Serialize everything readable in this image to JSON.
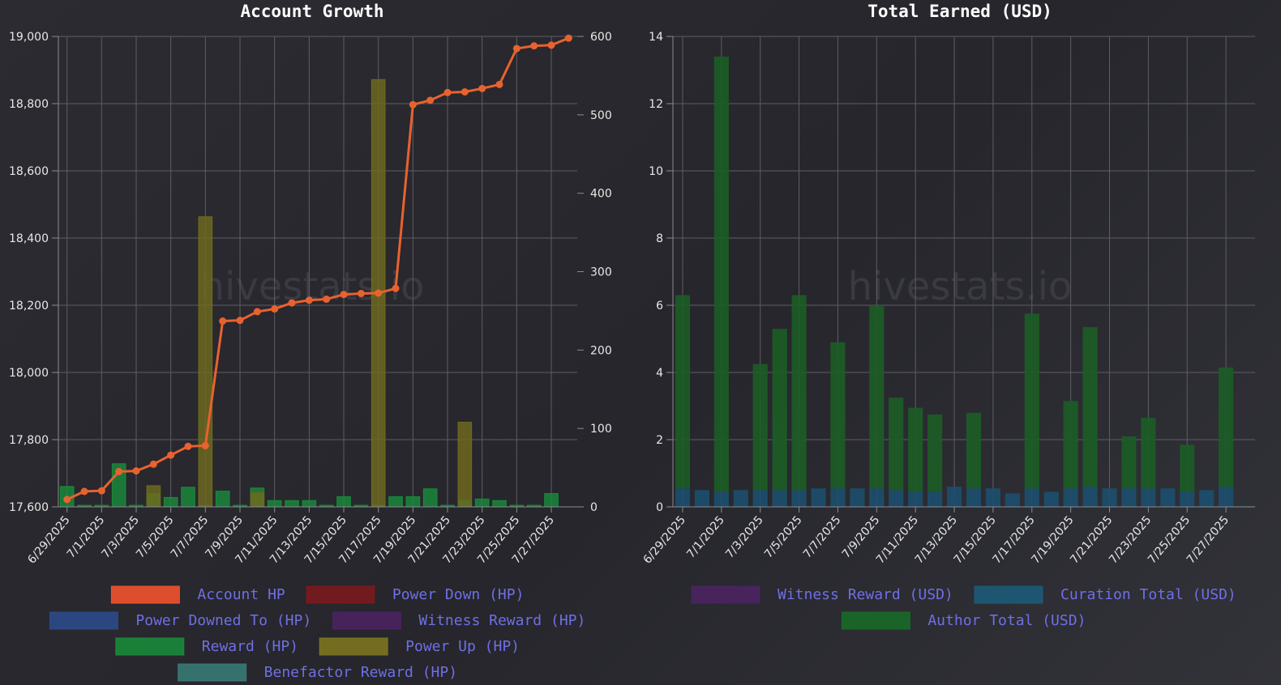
{
  "watermark": "hivestats.io",
  "chart_data": [
    {
      "type": "bar",
      "title": "Account Growth",
      "x_labels": [
        "6/29/2025",
        "7/1/2025",
        "7/3/2025",
        "7/5/2025",
        "7/7/2025",
        "7/9/2025",
        "7/11/2025",
        "7/13/2025",
        "7/15/2025",
        "7/17/2025",
        "7/19/2025",
        "7/21/2025",
        "7/23/2025",
        "7/25/2025",
        "7/27/2025"
      ],
      "dates": [
        "6/29/2025",
        "6/30/2025",
        "7/1/2025",
        "7/2/2025",
        "7/3/2025",
        "7/4/2025",
        "7/5/2025",
        "7/6/2025",
        "7/7/2025",
        "7/8/2025",
        "7/9/2025",
        "7/10/2025",
        "7/11/2025",
        "7/12/2025",
        "7/13/2025",
        "7/14/2025",
        "7/15/2025",
        "7/16/2025",
        "7/17/2025",
        "7/18/2025",
        "7/19/2025",
        "7/20/2025",
        "7/21/2025",
        "7/22/2025",
        "7/23/2025",
        "7/24/2025",
        "7/25/2025",
        "7/26/2025",
        "7/27/2025",
        "7/28/2025"
      ],
      "y_left": {
        "min": 17600,
        "max": 19000,
        "ticks": [
          17600,
          17800,
          18000,
          18200,
          18400,
          18600,
          18800,
          19000
        ],
        "tick_labels": [
          "17,600",
          "17,800",
          "18,000",
          "18,200",
          "18,400",
          "18,600",
          "18,800",
          "19,000"
        ]
      },
      "y_right": {
        "min": 0,
        "max": 600,
        "ticks": [
          0,
          100,
          200,
          300,
          400,
          500,
          600
        ],
        "tick_labels": [
          "0",
          "100",
          "200",
          "300",
          "400",
          "500",
          "600"
        ]
      },
      "grid": true,
      "legend_position": "bottom",
      "legend": [
        {
          "label": "Account HP",
          "color": "#f0522d"
        },
        {
          "label": "Power Down (HP)",
          "color": "#7a1a1e"
        },
        {
          "label": "Power Downed To (HP)",
          "color": "#2c4a8a"
        },
        {
          "label": "Witness Reward (HP)",
          "color": "#4a2360"
        },
        {
          "label": "Reward (HP)",
          "color": "#1a8a3a"
        },
        {
          "label": "Power Up (HP)",
          "color": "#7d7420"
        },
        {
          "label": "Benefactor Reward (HP)",
          "color": "#3a7a76"
        }
      ],
      "series": [
        {
          "name": "Account HP",
          "type": "line",
          "axis": "left",
          "color": "#e8622f",
          "values": [
            17622,
            17646,
            17648,
            17705,
            17707,
            17727,
            17754,
            17780,
            17782,
            18153,
            18155,
            18181,
            18189,
            18207,
            18215,
            18218,
            18232,
            18235,
            18236,
            18250,
            18797,
            18810,
            18833,
            18835,
            18845,
            18857,
            18964,
            18972,
            18974,
            18995
          ]
        },
        {
          "name": "Reward (HP)",
          "type": "bar",
          "axis": "right",
          "color": "#1a8a3a",
          "values": [
            26,
            2,
            2,
            55,
            2,
            17,
            12,
            25,
            2,
            20,
            2,
            24,
            8,
            8,
            8,
            2,
            13,
            2,
            2,
            13,
            13,
            23,
            2,
            8,
            10,
            8,
            2,
            2,
            17,
            0
          ]
        },
        {
          "name": "Power Up (HP)",
          "type": "bar",
          "axis": "right",
          "color": "#6f6a1e",
          "values": [
            0,
            0,
            0,
            0,
            0,
            27,
            0,
            0,
            370,
            0,
            0,
            18,
            0,
            0,
            0,
            0,
            0,
            0,
            545,
            0,
            0,
            0,
            0,
            108,
            0,
            0,
            0,
            0,
            0,
            0
          ]
        }
      ]
    },
    {
      "type": "bar",
      "title": "Total Earned (USD)",
      "x_labels": [
        "6/29/2025",
        "7/1/2025",
        "7/3/2025",
        "7/5/2025",
        "7/7/2025",
        "7/9/2025",
        "7/11/2025",
        "7/13/2025",
        "7/15/2025",
        "7/17/2025",
        "7/19/2025",
        "7/21/2025",
        "7/23/2025",
        "7/25/2025",
        "7/27/2025"
      ],
      "dates": [
        "6/29/2025",
        "6/30/2025",
        "7/1/2025",
        "7/2/2025",
        "7/3/2025",
        "7/4/2025",
        "7/5/2025",
        "7/6/2025",
        "7/7/2025",
        "7/8/2025",
        "7/9/2025",
        "7/10/2025",
        "7/11/2025",
        "7/12/2025",
        "7/13/2025",
        "7/14/2025",
        "7/15/2025",
        "7/16/2025",
        "7/17/2025",
        "7/18/2025",
        "7/19/2025",
        "7/20/2025",
        "7/21/2025",
        "7/22/2025",
        "7/23/2025",
        "7/24/2025",
        "7/25/2025",
        "7/26/2025",
        "7/27/2025",
        "7/28/2025"
      ],
      "y": {
        "min": 0,
        "max": 14,
        "ticks": [
          0,
          2,
          4,
          6,
          8,
          10,
          12,
          14
        ],
        "tick_labels": [
          "0",
          "2",
          "4",
          "6",
          "8",
          "10",
          "12",
          "14"
        ]
      },
      "grid": true,
      "legend_position": "bottom",
      "legend": [
        {
          "label": "Witness Reward (USD)",
          "color": "#4a2360"
        },
        {
          "label": "Curation Total (USD)",
          "color": "#1d5a78"
        },
        {
          "label": "Author Total (USD)",
          "color": "#1a6a28"
        }
      ],
      "series": [
        {
          "name": "Curation Total (USD)",
          "type": "bar",
          "stack": true,
          "color": "#1c4f6e",
          "values": [
            0.55,
            0.5,
            0.45,
            0.5,
            0.5,
            0.5,
            0.5,
            0.55,
            0.55,
            0.55,
            0.55,
            0.5,
            0.45,
            0.45,
            0.6,
            0.55,
            0.55,
            0.4,
            0.55,
            0.45,
            0.55,
            0.6,
            0.55,
            0.55,
            0.55,
            0.55,
            0.45,
            0.5,
            0.6,
            0.02
          ]
        },
        {
          "name": "Author Total (USD)",
          "type": "bar",
          "stack": true,
          "color": "#1c5d26",
          "values": [
            5.75,
            0,
            12.95,
            0,
            3.75,
            4.8,
            5.8,
            0,
            4.35,
            0,
            5.45,
            2.75,
            2.5,
            2.3,
            0,
            2.25,
            0,
            0,
            5.2,
            0,
            2.6,
            4.75,
            0,
            1.55,
            2.1,
            0,
            1.4,
            0,
            3.55,
            0
          ]
        }
      ]
    }
  ]
}
